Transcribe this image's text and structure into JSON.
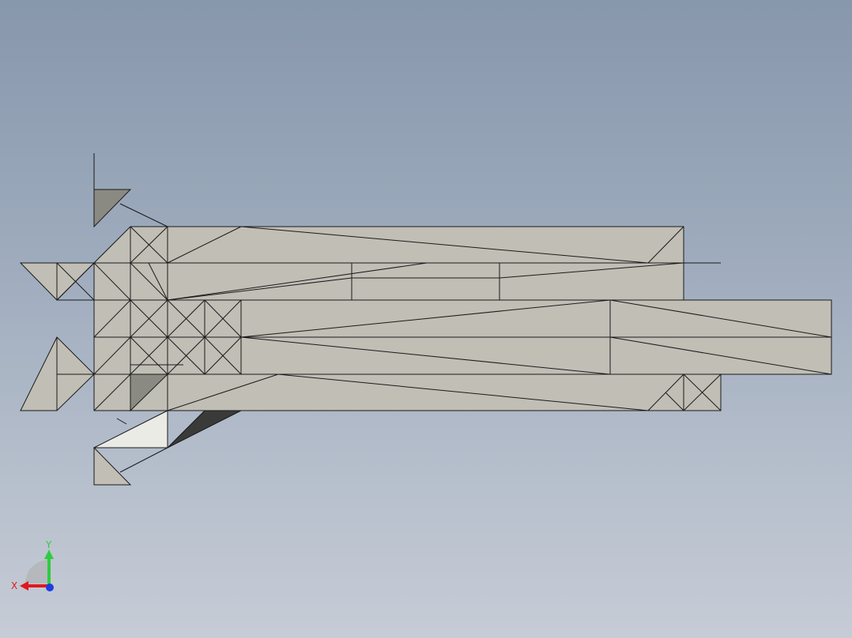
{
  "viewport": {
    "background_top": "#8797ac",
    "background_bottom": "#c6ccd6"
  },
  "model": {
    "face_color": "#c0beb5",
    "face_dark_color": "#8b8a82",
    "face_light_color": "#ebebe6",
    "face_black_color": "#3a3b38",
    "edge_color": "#1a1a1a"
  },
  "triad": {
    "x_label": "X",
    "y_label": "Y",
    "x_color": "#e0191e",
    "y_color": "#2ecc40",
    "z_color": "#1e3ce0"
  }
}
